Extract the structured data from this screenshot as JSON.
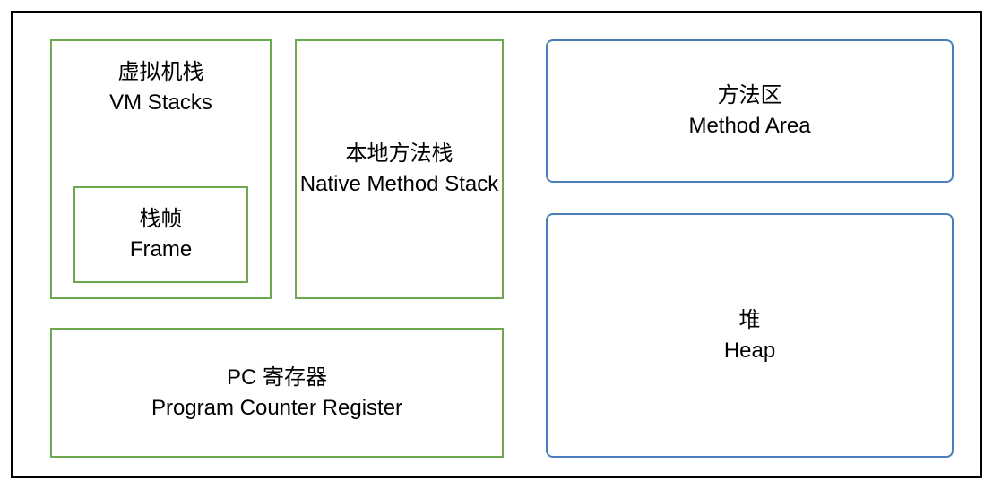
{
  "diagram": {
    "vmStacks": {
      "cn": "虚拟机栈",
      "en": "VM Stacks"
    },
    "frame": {
      "cn": "栈帧",
      "en": "Frame"
    },
    "nativeStack": {
      "cn": "本地方法栈",
      "en": "Native Method Stack"
    },
    "pcRegister": {
      "cn": "PC  寄存器",
      "en": "Program Counter Register"
    },
    "methodArea": {
      "cn": "方法区",
      "en": "Method Area"
    },
    "heap": {
      "cn": "堆",
      "en": "Heap"
    }
  },
  "colors": {
    "greenBorder": "#6ba84f",
    "blueBorder": "#4a7ebb",
    "outerBorder": "#000000"
  }
}
